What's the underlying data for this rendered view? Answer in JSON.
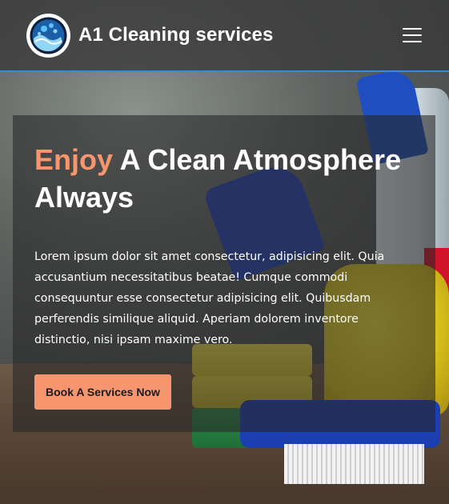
{
  "navbar": {
    "brand_name": "A1 Cleaning services",
    "logo_icon": "cleaning-bubbles-logo",
    "menu_icon": "hamburger-menu-icon",
    "accent_border_color": "#3f86d6"
  },
  "hero": {
    "headline_accent": "Enjoy",
    "headline_rest": " A Clean Atmosphere Always",
    "description": "Lorem ipsum dolor sit amet consectetur, adipisicing elit. Quia accusantium necessitatibus beatae! Cumque commodi consequuntur esse consectetur adipisicing elit. Quibusdam perferendis similique aliquid. Aperiam dolorem inventore distinctio, nisi ipsam maxime vero.",
    "cta_label": "Book A Services Now",
    "accent_color": "#f7956f"
  }
}
